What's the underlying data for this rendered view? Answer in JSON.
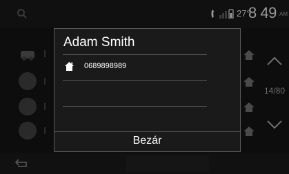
{
  "status": {
    "temperature": "27°",
    "clock": "8 49",
    "ampm": "AM"
  },
  "right_nav": {
    "page_indicator": "14/80"
  },
  "modal": {
    "title": "Adam Smith",
    "entries": [
      {
        "type": "home-icon",
        "number": "0689898989"
      }
    ],
    "close_label": "Bezár"
  },
  "colors": {
    "background": "#0d0d0d",
    "modal_background": "#1a1a1a",
    "modal_border": "#5a5a5a",
    "dim_text": "#9a9a9a"
  }
}
